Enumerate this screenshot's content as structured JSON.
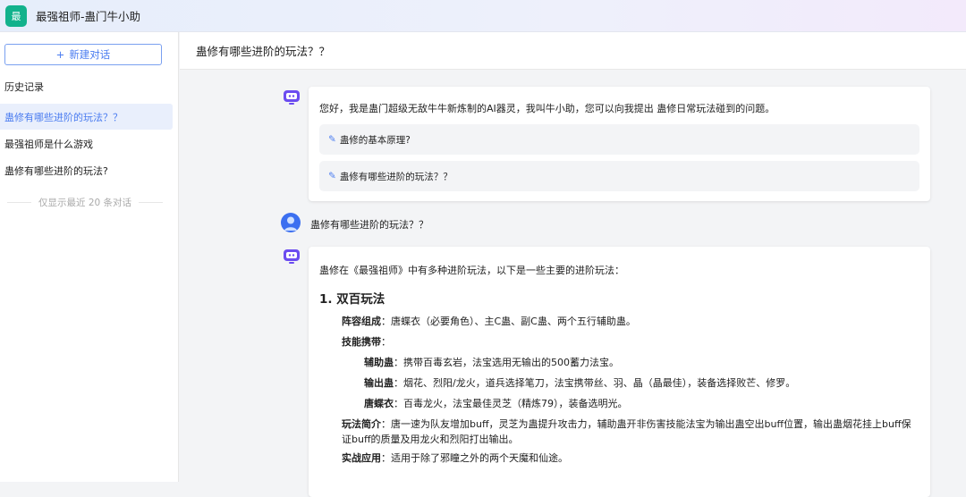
{
  "header": {
    "logo_char": "最",
    "title": "最强祖师-蛊门牛小助"
  },
  "sidebar": {
    "new_chat": "新建对话",
    "new_icon": "+",
    "history_label": "历史记录",
    "items": [
      {
        "label": "蛊修有哪些进阶的玩法？？"
      },
      {
        "label": "最强祖师是什么游戏"
      },
      {
        "label": "蛊修有哪些进阶的玩法?"
      }
    ],
    "note": "仅显示最近 20 条对话"
  },
  "chat": {
    "title": "蛊修有哪些进阶的玩法？？",
    "greeting": "您好，我是蛊门超级无敌牛牛新炼制的AI器灵，我叫牛小助，您可以向我提出 蛊修日常玩法碰到的问题。",
    "suggestions": [
      "蛊修的基本原理?",
      "蛊修有哪些进阶的玩法？？"
    ],
    "user_message": "蛊修有哪些进阶的玩法？？",
    "answer": {
      "intro": "蛊修在《最强祖师》中有多种进阶玩法，以下是一些主要的进阶玩法：",
      "heading": "1. 双百玩法",
      "lineup_label": "阵容组成",
      "lineup": "：唐蝶衣（必要角色）、主C蛊、副C蛊、两个五行辅助蛊。",
      "skills_label": "技能携带",
      "skills_colon": "：",
      "support_label": "辅助蛊",
      "support": "：携带百毒玄岩，法宝选用无输出的500蓄力法宝。",
      "dps_label": "输出蛊",
      "dps": "：烟花、烈阳/龙火，道兵选择笔刀，法宝携带丝、羽、晶（晶最佳），装备选择败芒、修罗。",
      "tang_label": "唐蝶衣",
      "tang": "：百毒龙火，法宝最佳灵芝（精炼79），装备选明光。",
      "intro2_label": "玩法简介",
      "intro2": "：唐一速为队友增加buff，灵芝为蛊提升攻击力，辅助蛊开非伤害技能法宝为输出蛊空出buff位置，输出蛊烟花挂上buff保证buff的质量及用龙火和烈阳打出输出。",
      "use_label": "实战应用",
      "use": "：适用于除了邪瞳之外的两个天魔和仙途。"
    }
  },
  "colors": {
    "accent": "#4a7cf0",
    "logo": "#12b28c",
    "bot": "#6b4cf0"
  }
}
